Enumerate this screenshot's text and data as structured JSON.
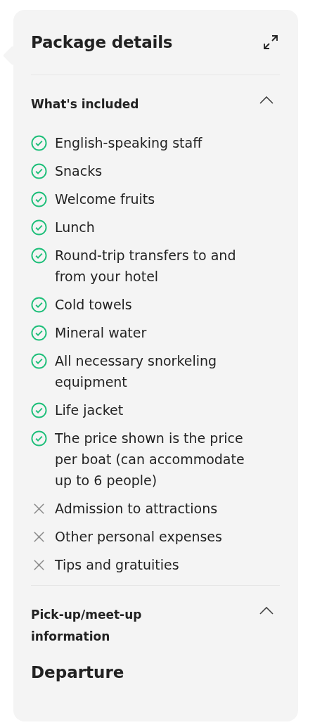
{
  "panel": {
    "title": "Package details"
  },
  "sections": [
    {
      "title": "What's included",
      "expanded": true,
      "items": [
        {
          "kind": "included",
          "text": "English-speaking staff"
        },
        {
          "kind": "included",
          "text": "Snacks"
        },
        {
          "kind": "included",
          "text": "Welcome fruits"
        },
        {
          "kind": "included",
          "text": "Lunch"
        },
        {
          "kind": "included",
          "text": "Round-trip transfers to and from your hotel"
        },
        {
          "kind": "included",
          "text": "Cold towels"
        },
        {
          "kind": "included",
          "text": "Mineral water"
        },
        {
          "kind": "included",
          "text": "All necessary snorkeling equipment"
        },
        {
          "kind": "included",
          "text": "Life jacket"
        },
        {
          "kind": "included",
          "text": "The price shown is the price per boat (can accommodate up to 6 people)"
        },
        {
          "kind": "excluded",
          "text": "Admission to attractions"
        },
        {
          "kind": "excluded",
          "text": "Other personal expenses"
        },
        {
          "kind": "excluded",
          "text": "Tips and gratuities"
        }
      ]
    },
    {
      "title": "Pick-up/meet-up information",
      "expanded": true,
      "subheading": "Departure"
    }
  ]
}
